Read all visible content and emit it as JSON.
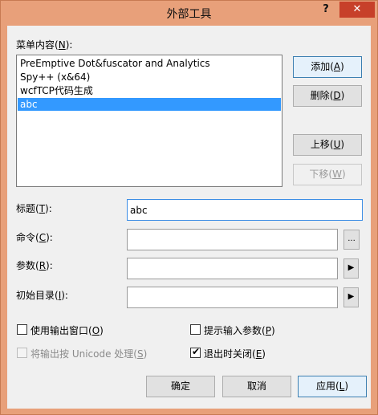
{
  "window": {
    "title": "外部工具",
    "help": "?",
    "close": "✕"
  },
  "menu": {
    "label": "菜单内容",
    "accel": "N",
    "items": [
      "PreEmptive Dot&fuscator and Analytics",
      "Spy++ (x&64)",
      "wcfTCP代码生成",
      "abc"
    ],
    "selected_index": 3
  },
  "buttons": {
    "add": {
      "label": "添加",
      "accel": "A"
    },
    "delete": {
      "label": "删除",
      "accel": "D"
    },
    "move_up": {
      "label": "上移",
      "accel": "U"
    },
    "move_down": {
      "label": "下移",
      "accel": "W"
    },
    "ok": "确定",
    "cancel": "取消",
    "apply": {
      "label": "应用",
      "accel": "L"
    }
  },
  "fields": {
    "title": {
      "label": "标题",
      "accel": "T",
      "value": "abc"
    },
    "command": {
      "label": "命令",
      "accel": "C",
      "value": ""
    },
    "args": {
      "label": "参数",
      "accel": "R",
      "value": ""
    },
    "initdir": {
      "label": "初始目录",
      "accel": "I",
      "value": ""
    },
    "browse": "...",
    "arrow": "▶"
  },
  "options": {
    "use_output": {
      "label": "使用输出窗口",
      "accel": "O",
      "checked": false
    },
    "prompt_args": {
      "label": "提示输入参数",
      "accel": "P",
      "checked": false
    },
    "unicode": {
      "label": "将输出按 Unicode 处理",
      "accel": "S",
      "checked": false
    },
    "close_on_exit": {
      "label": "退出时关闭",
      "accel": "E",
      "checked": true
    },
    "checkmark": "✔"
  }
}
